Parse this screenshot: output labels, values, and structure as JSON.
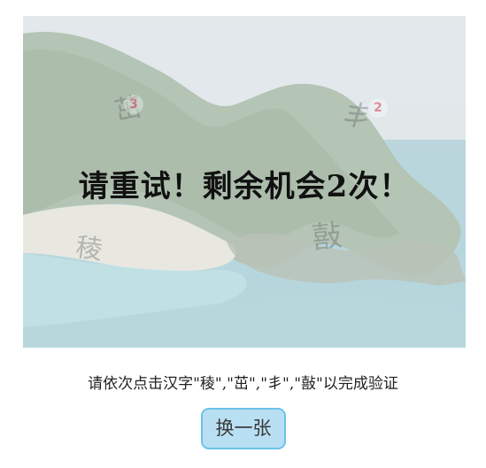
{
  "captcha": {
    "message": "请重试！剩余机会2次！",
    "image_glyphs": [
      "稜",
      "茁",
      "丯",
      "敼"
    ],
    "markers": [
      "3",
      "2"
    ],
    "instruction": "请依次点击汉字\"稜\",\"茁\",\"丯\",\"敼\"以完成验证",
    "refresh_label": "换一张"
  },
  "colors": {
    "button_background": "#b9dff3",
    "button_border": "#6cc3ea",
    "message_text": "#111111"
  }
}
